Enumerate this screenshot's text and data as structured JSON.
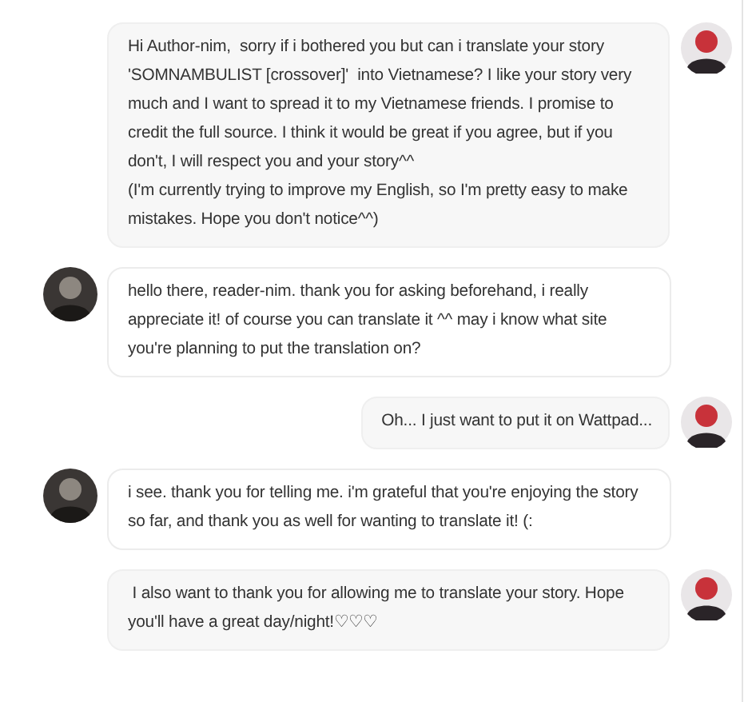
{
  "messages": [
    {
      "kind": "sent",
      "text": "Hi Author-nim,  sorry if i bothered you but can i translate your story 'SOMNAMBULIST [crossover]'  into Vietnamese? I like your story very much and I want to spread it to my Vietnamese friends. I promise to credit the full source. I think it would be great if you agree, but if you don't, I will respect you and your story^^\n(I'm currently trying to improve my English, so I'm pretty easy to make mistakes. Hope you don't notice^^)"
    },
    {
      "kind": "received",
      "text": "hello there, reader-nim. thank you for asking beforehand, i really appreciate it! of course you can translate it ^^ may i know what site you're planning to put the translation on?"
    },
    {
      "kind": "sent",
      "text": "Oh... I just want to put it on Wattpad..."
    },
    {
      "kind": "received",
      "text": "i see. thank you for telling me. i'm grateful that you're enjoying the story so far, and thank you as well for wanting to translate it! (:"
    },
    {
      "kind": "sent",
      "text": " I also want to thank you for allowing me to translate your story. Hope you'll have a great day/night!♡♡♡"
    }
  ]
}
